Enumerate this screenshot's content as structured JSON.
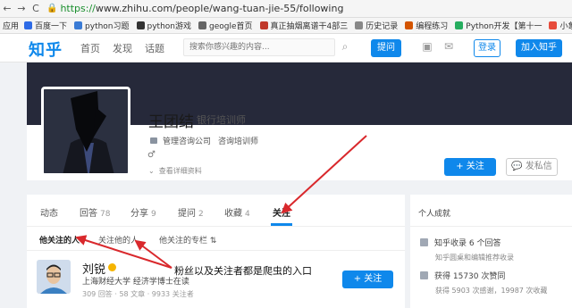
{
  "browser": {
    "back": "←",
    "forward": "→",
    "reload": "C",
    "url_scheme": "https://",
    "url_rest": "www.zhihu.com/people/wang-tuan-jie-55/following",
    "bookmarks_label": "应用",
    "bookmarks": [
      {
        "label": "百度一下",
        "color": "#2e6be6"
      },
      {
        "label": "python习题",
        "color": "#3a7bd5"
      },
      {
        "label": "python游戏",
        "color": "#333333"
      },
      {
        "label": "geogle首页",
        "color": "#666666"
      },
      {
        "label": "真正抽烟离谱干4部三",
        "color": "#c0392b"
      },
      {
        "label": "历史记录",
        "color": "#888888"
      },
      {
        "label": "编程练习",
        "color": "#d35400"
      },
      {
        "label": "Python开发【第十一",
        "color": "#27ae60"
      },
      {
        "label": "小象学院 - 中国最专",
        "color": "#e74c3c"
      }
    ]
  },
  "header": {
    "logo": "知乎",
    "nav": [
      "首页",
      "发现",
      "话题"
    ],
    "search_placeholder": "搜索你感兴趣的内容...",
    "ask": "提问",
    "login": "登录",
    "join": "加入知乎"
  },
  "profile": {
    "name": "王团结",
    "headline": "银行培训师",
    "industry": "管理咨询公司",
    "job": "咨询培训师",
    "gender_icon": "♂",
    "detail_link": "查看详细资料",
    "follow": "+ 关注",
    "message": "发私信"
  },
  "tabs": [
    {
      "label": "动态",
      "count": ""
    },
    {
      "label": "回答",
      "count": "78"
    },
    {
      "label": "分享",
      "count": "9"
    },
    {
      "label": "提问",
      "count": "2"
    },
    {
      "label": "收藏",
      "count": "4"
    },
    {
      "label": "关注",
      "count": ""
    }
  ],
  "subtabs": [
    "他关注的人",
    "关注他的人",
    "他关注的专栏"
  ],
  "list": [
    {
      "name": "刘锐",
      "headline": "上海财经大学 经济学博士在读",
      "stats": "309 回答 · 58 文章 · 9933 关注者",
      "follow": "+ 关注"
    }
  ],
  "sidebar": {
    "title": "个人成就",
    "rows": [
      {
        "label": "知乎收录 6 个回答",
        "sub": "知乎圆桌和编辑推荐收录"
      },
      {
        "label": "获得 15730 次赞同",
        "sub": "获得 5903 次感谢，19987 次收藏"
      }
    ]
  },
  "annotation": "粉丝以及关注者都是爬虫的入口",
  "colors": {
    "brand": "#0f88eb",
    "annotation_arrow": "#d9282c"
  }
}
